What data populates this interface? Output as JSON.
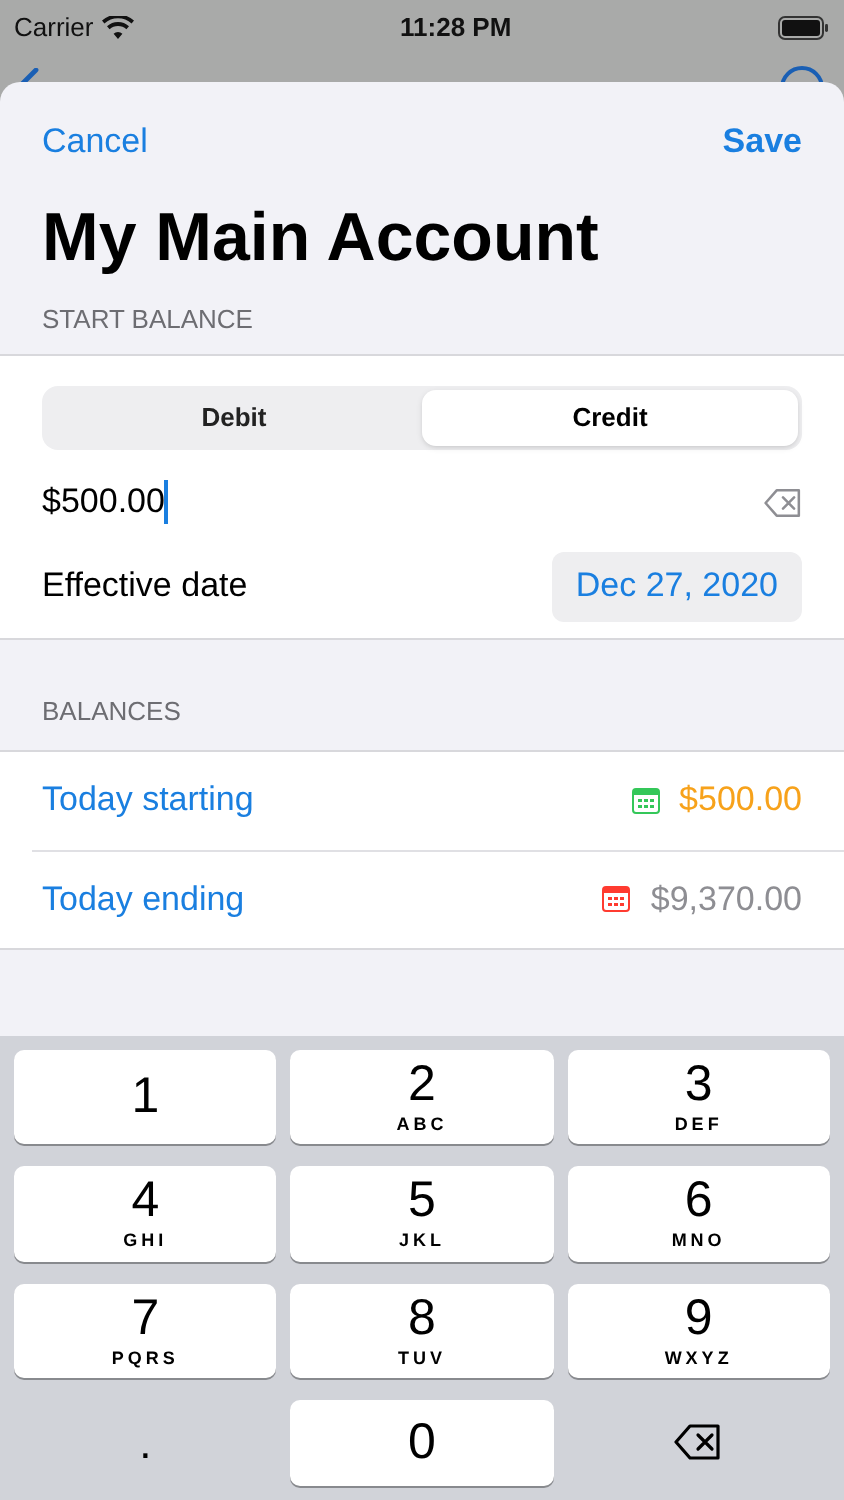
{
  "status_bar": {
    "carrier": "Carrier",
    "time": "11:28 PM"
  },
  "sheet": {
    "cancel": "Cancel",
    "save": "Save",
    "title": "My Main Account",
    "start_balance": {
      "header": "START BALANCE",
      "segments": [
        {
          "label": "Debit",
          "selected": false
        },
        {
          "label": "Credit",
          "selected": true
        }
      ],
      "amount": {
        "value": "$500.00"
      },
      "effective_date": {
        "label": "Effective date",
        "value": "Dec 27, 2020"
      }
    },
    "balances": {
      "header": "BALANCES",
      "rows": [
        {
          "label": "Today starting",
          "value": "$500.00",
          "color": "#34c759",
          "kind": "pending"
        },
        {
          "label": "Today ending",
          "value": "$9,370.00",
          "color": "#ff3b30",
          "kind": "projected"
        }
      ]
    }
  },
  "keyboard": {
    "keys": [
      {
        "kind": "digit",
        "digit": "1"
      },
      {
        "kind": "digit",
        "digit": "2",
        "letters": "ABC"
      },
      {
        "kind": "digit",
        "digit": "3",
        "letters": "DEF"
      },
      {
        "kind": "digit",
        "digit": "4",
        "letters": "GHI"
      },
      {
        "kind": "digit",
        "digit": "5",
        "letters": "JKL"
      },
      {
        "kind": "digit",
        "digit": "6",
        "letters": "MNO"
      },
      {
        "kind": "digit",
        "digit": "7",
        "letters": "PQRS"
      },
      {
        "kind": "digit",
        "digit": "8",
        "letters": "TUV"
      },
      {
        "kind": "digit",
        "digit": "9",
        "letters": "WXYZ"
      },
      {
        "kind": "plain",
        "digit": "."
      },
      {
        "kind": "digit",
        "digit": "0"
      },
      {
        "kind": "delete"
      }
    ]
  }
}
